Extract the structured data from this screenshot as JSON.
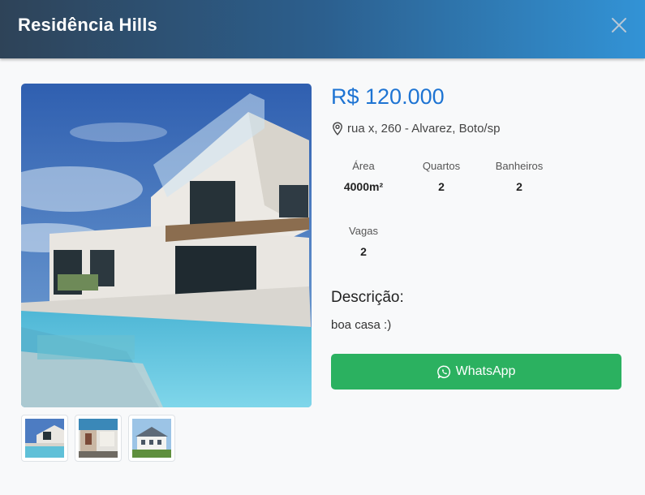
{
  "modal": {
    "title": "Residência Hills",
    "price": "R$ 120.000",
    "address": "rua x, 260 - Alvarez, Boto/sp",
    "features": [
      {
        "label": "Área",
        "value": "4000m²"
      },
      {
        "label": "Quartos",
        "value": "2"
      },
      {
        "label": "Banheiros",
        "value": "2"
      },
      {
        "label": "Vagas",
        "value": "2"
      }
    ],
    "description_title": "Descrição:",
    "description": "boa casa :)",
    "whatsapp_label": "WhatsApp",
    "icons": {
      "close": "close-icon",
      "location": "map-pin-icon",
      "whatsapp": "whatsapp-icon"
    },
    "colors": {
      "header_start": "#2e4358",
      "header_end": "#3293d6",
      "price": "#1e74d3",
      "whatsapp": "#2bb160"
    }
  }
}
